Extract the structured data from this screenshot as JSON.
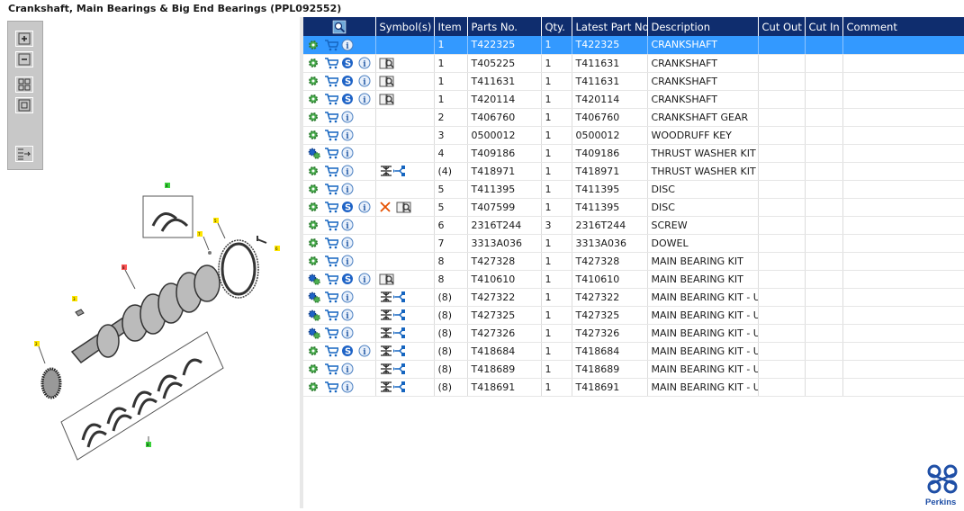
{
  "window": {
    "title": "Crankshaft, Main Bearings & Big End Bearings (PPL092552)"
  },
  "toolbar": {
    "buttons": [
      {
        "name": "zoom-in",
        "icon": "zoom-in-icon"
      },
      {
        "name": "zoom-out",
        "icon": "zoom-out-icon"
      },
      {
        "name": "fit-all",
        "icon": "fit-all-icon"
      },
      {
        "name": "fit-window",
        "icon": "fit-window-icon"
      },
      {
        "name": "export",
        "icon": "export-icon"
      }
    ]
  },
  "diagram": {
    "callouts": [
      "4",
      "7",
      "5",
      "6",
      "8",
      "3",
      "2",
      "8"
    ]
  },
  "table": {
    "columns": [
      "",
      "Symbol(s)",
      "Item",
      "Parts No.",
      "Qty.",
      "Latest Part No.",
      "Description",
      "Cut Out",
      "Cut In",
      "Comment"
    ],
    "rows": [
      {
        "selected": true,
        "gears": false,
        "s": false,
        "sym": [],
        "item": "1",
        "part": "T422325",
        "qty": "1",
        "latest": "T422325",
        "desc": "CRANKSHAFT"
      },
      {
        "selected": false,
        "gears": false,
        "s": true,
        "sym": [
          "book"
        ],
        "item": "1",
        "part": "T405225",
        "qty": "1",
        "latest": "T411631",
        "desc": "CRANKSHAFT"
      },
      {
        "selected": false,
        "gears": false,
        "s": true,
        "sym": [
          "book"
        ],
        "item": "1",
        "part": "T411631",
        "qty": "1",
        "latest": "T411631",
        "desc": "CRANKSHAFT"
      },
      {
        "selected": false,
        "gears": false,
        "s": true,
        "sym": [
          "book"
        ],
        "item": "1",
        "part": "T420114",
        "qty": "1",
        "latest": "T420114",
        "desc": "CRANKSHAFT"
      },
      {
        "selected": false,
        "gears": false,
        "s": false,
        "sym": [],
        "item": "2",
        "part": "T406760",
        "qty": "1",
        "latest": "T406760",
        "desc": "CRANKSHAFT GEAR"
      },
      {
        "selected": false,
        "gears": false,
        "s": false,
        "sym": [],
        "item": "3",
        "part": "0500012",
        "qty": "1",
        "latest": "0500012",
        "desc": "WOODRUFF KEY"
      },
      {
        "selected": false,
        "gears": true,
        "s": false,
        "sym": [],
        "item": "4",
        "part": "T409186",
        "qty": "1",
        "latest": "T409186",
        "desc": "THRUST WASHER KIT"
      },
      {
        "selected": false,
        "gears": false,
        "s": false,
        "sym": [
          "kit"
        ],
        "item": "(4)",
        "part": "T418971",
        "qty": "1",
        "latest": "T418971",
        "desc": "THRUST WASHER KIT - O"
      },
      {
        "selected": false,
        "gears": false,
        "s": false,
        "sym": [],
        "item": "5",
        "part": "T411395",
        "qty": "1",
        "latest": "T411395",
        "desc": "DISC"
      },
      {
        "selected": false,
        "gears": false,
        "s": true,
        "sym": [
          "cross",
          "book"
        ],
        "item": "5",
        "part": "T407599",
        "qty": "1",
        "latest": "T411395",
        "desc": "DISC"
      },
      {
        "selected": false,
        "gears": false,
        "s": false,
        "sym": [],
        "item": "6",
        "part": "2316T244",
        "qty": "3",
        "latest": "2316T244",
        "desc": "SCREW"
      },
      {
        "selected": false,
        "gears": false,
        "s": false,
        "sym": [],
        "item": "7",
        "part": "3313A036",
        "qty": "1",
        "latest": "3313A036",
        "desc": "DOWEL"
      },
      {
        "selected": false,
        "gears": false,
        "s": false,
        "sym": [],
        "item": "8",
        "part": "T427328",
        "qty": "1",
        "latest": "T427328",
        "desc": "MAIN BEARING KIT"
      },
      {
        "selected": false,
        "gears": true,
        "s": true,
        "sym": [
          "book"
        ],
        "item": "8",
        "part": "T410610",
        "qty": "1",
        "latest": "T410610",
        "desc": "MAIN BEARING KIT"
      },
      {
        "selected": false,
        "gears": true,
        "s": false,
        "sym": [
          "kit"
        ],
        "item": "(8)",
        "part": "T427322",
        "qty": "1",
        "latest": "T427322",
        "desc": "MAIN BEARING KIT - U/S"
      },
      {
        "selected": false,
        "gears": true,
        "s": false,
        "sym": [
          "kit"
        ],
        "item": "(8)",
        "part": "T427325",
        "qty": "1",
        "latest": "T427325",
        "desc": "MAIN BEARING KIT - U/S"
      },
      {
        "selected": false,
        "gears": true,
        "s": false,
        "sym": [
          "kit"
        ],
        "item": "(8)",
        "part": "T427326",
        "qty": "1",
        "latest": "T427326",
        "desc": "MAIN BEARING KIT - U/S"
      },
      {
        "selected": false,
        "gears": false,
        "s": true,
        "sym": [
          "kit"
        ],
        "item": "(8)",
        "part": "T418684",
        "qty": "1",
        "latest": "T418684",
        "desc": "MAIN BEARING KIT - U/S"
      },
      {
        "selected": false,
        "gears": false,
        "s": false,
        "sym": [
          "kit"
        ],
        "item": "(8)",
        "part": "T418689",
        "qty": "1",
        "latest": "T418689",
        "desc": "MAIN BEARING KIT - U/S"
      },
      {
        "selected": false,
        "gears": false,
        "s": false,
        "sym": [
          "kit"
        ],
        "item": "(8)",
        "part": "T418691",
        "qty": "1",
        "latest": "T418691",
        "desc": "MAIN BEARING KIT - U/S"
      }
    ]
  },
  "logo": {
    "text": "Perkins"
  },
  "colors": {
    "header": "#0f2d6e",
    "selected": "#3399ff",
    "accent": "#1565c0"
  }
}
